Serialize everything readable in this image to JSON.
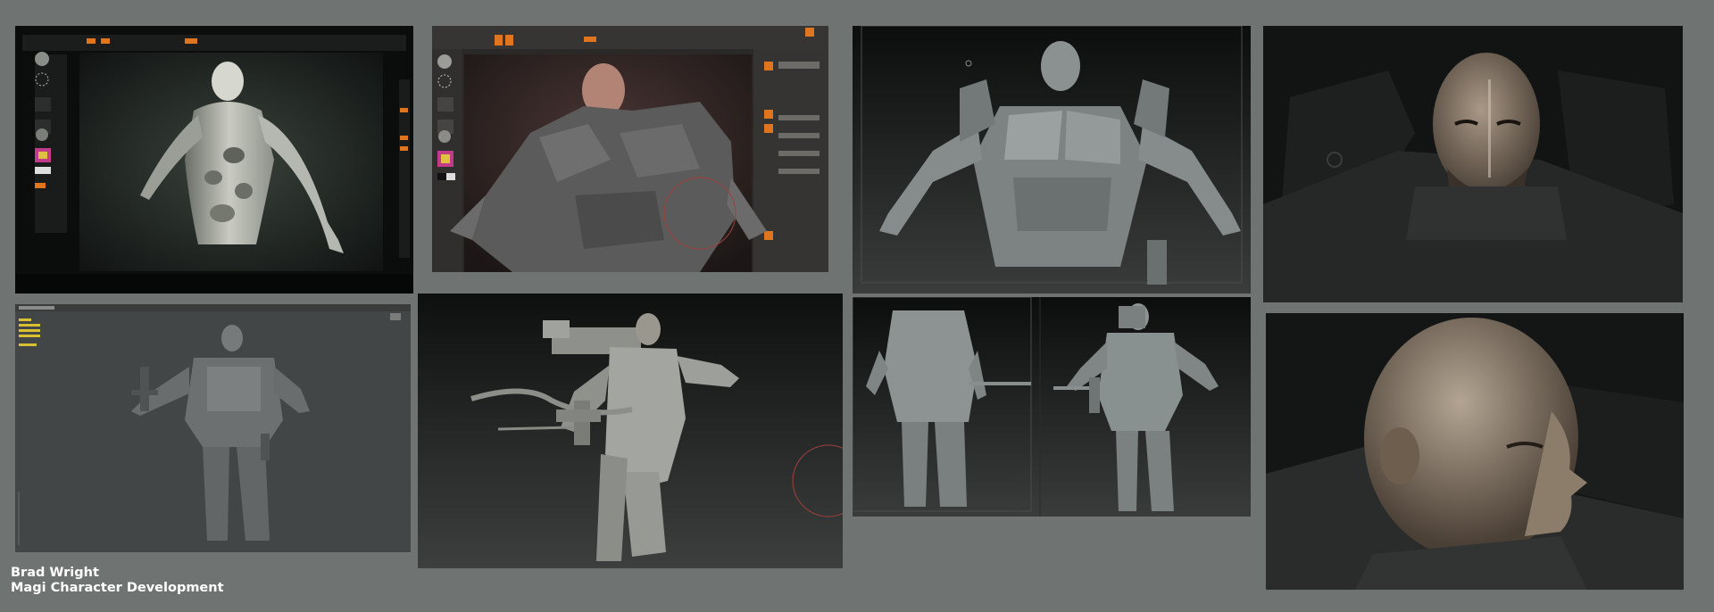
{
  "colors": {
    "background": "#6f7473",
    "caption_text": "#ffffff",
    "zbrush_orange": "#e0751f",
    "panel_dark": "#121414"
  },
  "credits": {
    "artist": "Brad Wright",
    "project": "Magi Character Development"
  },
  "panels": [
    {
      "name": "zbrush-screen-photo-anatomy-sculpt"
    },
    {
      "name": "zbrush-interface-armored-bust"
    },
    {
      "name": "armor-sculpt-front-view"
    },
    {
      "name": "head-render-three-quarter"
    },
    {
      "name": "viewport-wire-model-front"
    },
    {
      "name": "armor-model-with-cannon-side"
    },
    {
      "name": "armor-model-turnaround"
    },
    {
      "name": "head-render-profile-closeup"
    }
  ]
}
